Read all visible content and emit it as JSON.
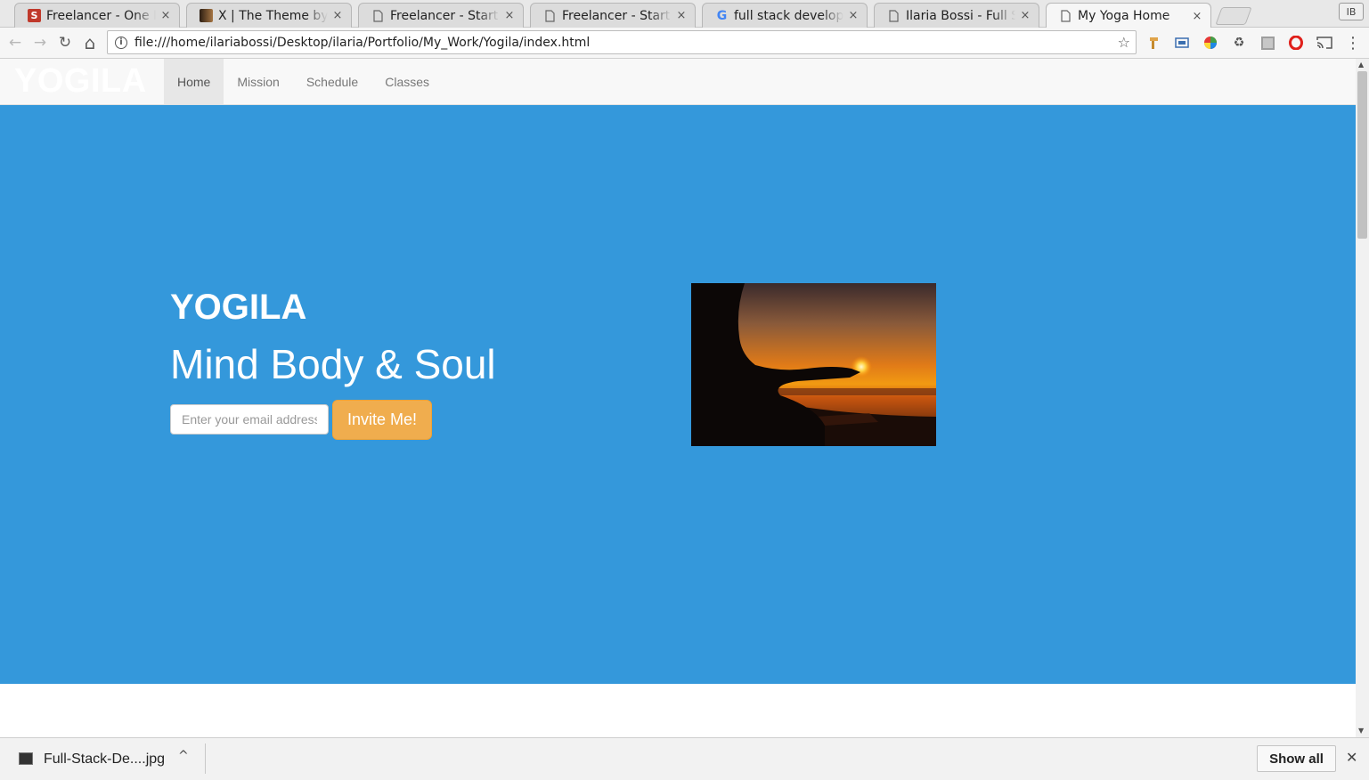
{
  "browser": {
    "tabs": [
      {
        "title": "Freelancer - One Pa",
        "favicon": "s-logo-icon",
        "favicon_text": "S",
        "favicon_color": "#c0392b"
      },
      {
        "title": "X | The Theme by TH",
        "favicon": "x-theme-icon",
        "favicon_text": "",
        "favicon_color": "#4a3a2a"
      },
      {
        "title": "Freelancer - Start B",
        "favicon": "page-icon",
        "favicon_text": "",
        "favicon_color": ""
      },
      {
        "title": "Freelancer - Start B",
        "favicon": "page-icon",
        "favicon_text": "",
        "favicon_color": ""
      },
      {
        "title": "full stack developm",
        "favicon": "google-icon",
        "favicon_text": "G",
        "favicon_color": ""
      },
      {
        "title": "Ilaria Bossi - Full St",
        "favicon": "page-icon",
        "favicon_text": "",
        "favicon_color": ""
      },
      {
        "title": "My Yoga Home",
        "favicon": "page-icon",
        "favicon_text": "",
        "favicon_color": "",
        "active": true
      }
    ],
    "close_glyph": "×",
    "profile_label": "IB",
    "url": "file:///home/ilariabossi/Desktop/ilaria/Portfolio/My_Work/Yogila/index.html",
    "nav": {
      "back": "←",
      "forward": "→",
      "reload": "↻",
      "home": "⌂",
      "star": "☆"
    }
  },
  "site": {
    "brand": "YOGILA",
    "menu": [
      {
        "label": "Home",
        "active": true
      },
      {
        "label": "Mission"
      },
      {
        "label": "Schedule"
      },
      {
        "label": "Classes"
      }
    ],
    "hero": {
      "title": "YOGILA",
      "subtitle": "Mind Body & Soul",
      "email_placeholder": "Enter your email address",
      "button_label": "Invite Me!",
      "background_color": "#3498db",
      "button_color": "#f0ad4e"
    }
  },
  "downloads": {
    "file_name": "Full-Stack-De....jpg",
    "chevron": "^",
    "show_all_label": "Show all",
    "close_glyph": "✕"
  }
}
